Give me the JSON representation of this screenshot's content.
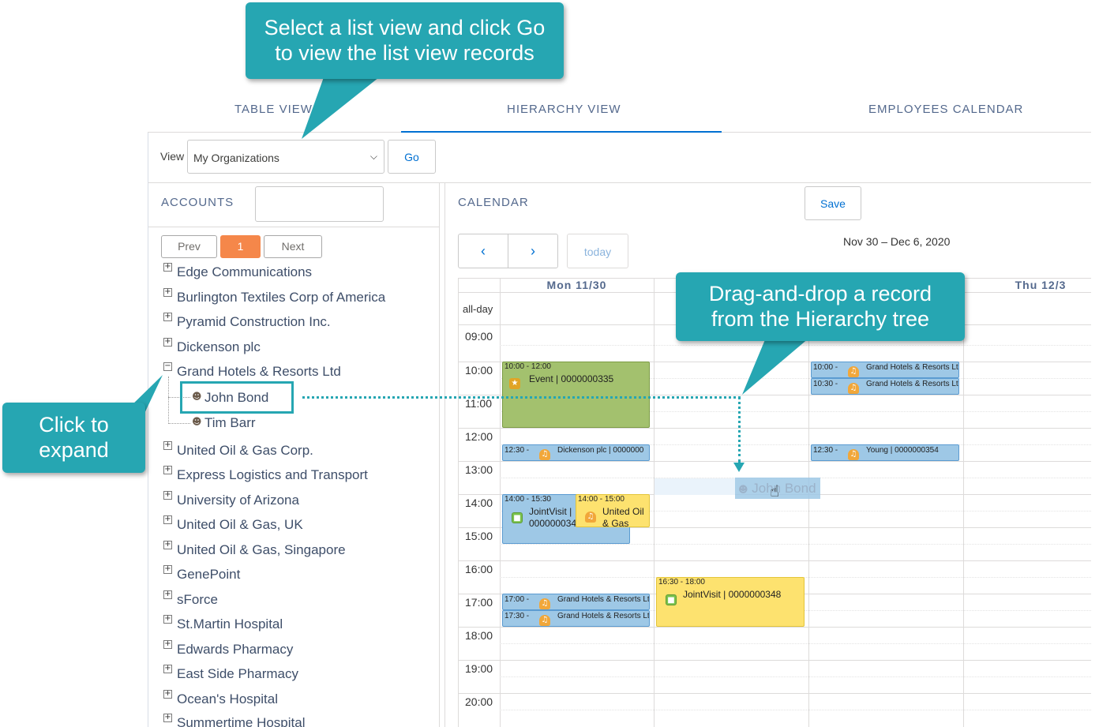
{
  "tabs": [
    {
      "label": "TABLE VIEW"
    },
    {
      "label": "HIERARCHY VIEW"
    },
    {
      "label": "EMPLOYEES CALENDAR"
    }
  ],
  "view_bar": {
    "label": "View",
    "selected": "My Organizations",
    "go_label": "Go"
  },
  "accounts": {
    "title": "ACCOUNTS",
    "pager": {
      "prev": "Prev",
      "current": "1",
      "next": "Next"
    },
    "items": [
      {
        "name": "Edge Communications",
        "expander": "+"
      },
      {
        "name": "Burlington Textiles Corp of America",
        "expander": "+"
      },
      {
        "name": "Pyramid Construction Inc.",
        "expander": "+"
      },
      {
        "name": "Dickenson plc",
        "expander": "+"
      },
      {
        "name": "Grand Hotels & Resorts Ltd",
        "expander": "−"
      },
      {
        "name": "United Oil & Gas Corp.",
        "expander": "+"
      },
      {
        "name": "Express Logistics and Transport",
        "expander": "+"
      },
      {
        "name": "University of Arizona",
        "expander": "+"
      },
      {
        "name": "United Oil & Gas, UK",
        "expander": "+"
      },
      {
        "name": "United Oil & Gas, Singapore",
        "expander": "+"
      },
      {
        "name": "GenePoint",
        "expander": "+"
      },
      {
        "name": "sForce",
        "expander": "+"
      },
      {
        "name": "St.Martin Hospital",
        "expander": "+"
      },
      {
        "name": "Edwards Pharmacy",
        "expander": "+"
      },
      {
        "name": "East Side Pharmacy",
        "expander": "+"
      },
      {
        "name": "Ocean's Hospital",
        "expander": "+"
      },
      {
        "name": "Summertime Hospital",
        "expander": "+"
      }
    ],
    "children": [
      {
        "name": "John Bond"
      },
      {
        "name": "Tim Barr"
      }
    ]
  },
  "calendar": {
    "title": "CALENDAR",
    "save_label": "Save",
    "date_range": "Nov 30 – Dec 6, 2020",
    "today_label": "today",
    "prev_icon": "chevron-left-icon",
    "next_icon": "chevron-right-icon",
    "prev_glyph": "‹",
    "next_glyph": "›",
    "days": [
      "Mon 11/30",
      "",
      "",
      "Thu 12/3"
    ],
    "allday_label": "all-day",
    "hours": [
      "09:00",
      "10:00",
      "11:00",
      "12:00",
      "13:00",
      "14:00",
      "15:00",
      "16:00",
      "17:00",
      "18:00",
      "19:00",
      "20:00"
    ],
    "events": [
      {
        "time": "10:00 - 12:00",
        "title": "Event | 0000000335",
        "icon": "trophy-icon"
      },
      {
        "time": "12:30 -",
        "title": "Dickenson plc | 0000000",
        "icon": "bell-icon"
      },
      {
        "time": "14:00 - 15:30",
        "title": "JointVisit |",
        "title2": "000000034",
        "icon": "map-icon"
      },
      {
        "time": "14:00 - 15:00",
        "title": "United Oil",
        "title2": "& Gas",
        "icon": "bell-icon"
      },
      {
        "time": "17:00 -",
        "title": "Grand Hotels & Resorts Lt",
        "icon": "bell-icon"
      },
      {
        "time": "17:30 -",
        "title": "Grand Hotels & Resorts Lt",
        "icon": "bell-icon"
      },
      {
        "time": "16:30 - 18:00",
        "title": "JointVisit | 0000000348",
        "icon": "map-icon"
      },
      {
        "time": "10:00 -",
        "title": "Grand Hotels & Resorts Lt",
        "icon": "bell-icon"
      },
      {
        "time": "10:30 -",
        "title": "Grand Hotels & Resorts Lt",
        "icon": "bell-icon"
      },
      {
        "time": "12:30 -",
        "title": "Young | 0000000354",
        "icon": "bell-icon"
      }
    ],
    "drag_ghost": "John Bond"
  },
  "callouts": {
    "top": "Select a list view and click Go to view the list view records",
    "top_line1": "Select a list view and click Go",
    "top_line2": "to view the list view records",
    "left_line1": "Click to",
    "left_line2": "expand",
    "right_line1": "Drag-and-drop a record",
    "right_line2": "from the Hierarchy tree"
  },
  "colors": {
    "accent": "#0070d2",
    "callout": "#26a6b2",
    "pager_current": "#f5874a",
    "event_blue": "#9ec8e6",
    "event_green": "#a3c16e",
    "event_yellow": "#fde26f"
  }
}
